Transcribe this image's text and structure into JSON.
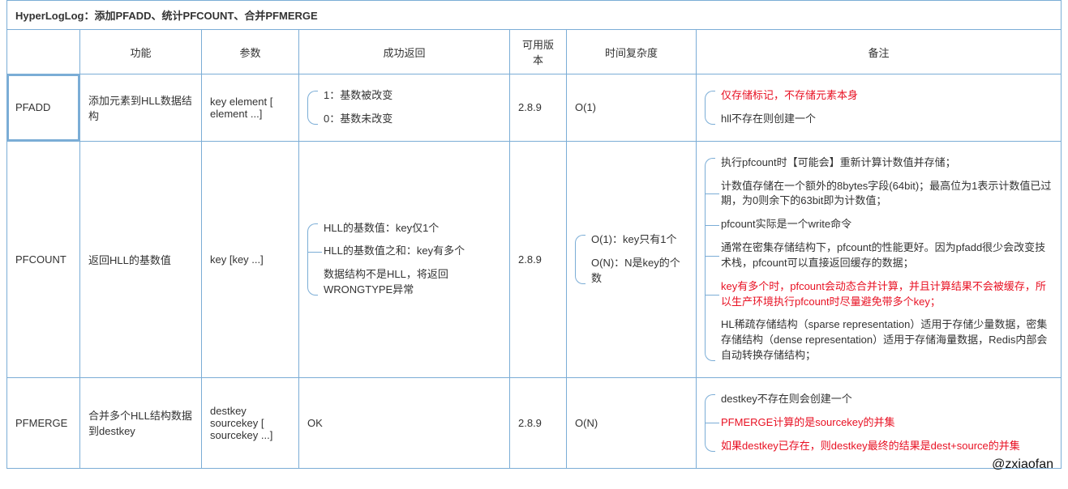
{
  "title": "HyperLogLog：添加PFADD、统计PFCOUNT、合并PFMERGE",
  "watermark": "@zxiaofan",
  "headers": {
    "cmd": "",
    "func": "功能",
    "param": "参数",
    "ret": "成功返回",
    "ver": "可用版本",
    "complexity": "时间复杂度",
    "note": "备注"
  },
  "rows": [
    {
      "cmd": "PFADD",
      "func": "添加元素到HLL数据结构",
      "param": "key element [ element ...]",
      "ret": {
        "items": [
          {
            "text": "1：基数被改变"
          },
          {
            "text": "0：基数未改变"
          }
        ]
      },
      "ver": "2.8.9",
      "complexity": {
        "plain": "O(1)"
      },
      "note": {
        "items": [
          {
            "text": "仅存储标记，不存储元素本身",
            "red": true
          },
          {
            "text": "hll不存在则创建一个"
          }
        ]
      }
    },
    {
      "cmd": "PFCOUNT",
      "func": "返回HLL的基数值",
      "param": "key [key ...]",
      "ret": {
        "items": [
          {
            "text": "HLL的基数值：key仅1个"
          },
          {
            "text": "HLL的基数值之和：key有多个"
          },
          {
            "text": "数据结构不是HLL，将返回WRONGTYPE异常"
          }
        ]
      },
      "ver": "2.8.9",
      "complexity": {
        "items": [
          {
            "text": "O(1)：key只有1个"
          },
          {
            "text": "O(N)：N是key的个数"
          }
        ]
      },
      "note": {
        "items": [
          {
            "text": "执行pfcount时【可能会】重新计算计数值并存储；"
          },
          {
            "text": "计数值存储在一个额外的8bytes字段(64bit)；最高位为1表示计数值已过期，为0则余下的63bit即为计数值；"
          },
          {
            "text": "pfcount实际是一个write命令"
          },
          {
            "text": "通常在密集存储结构下，pfcount的性能更好。因为pfadd很少会改变技术栈，pfcount可以直接返回缓存的数据；"
          },
          {
            "text": "key有多个时，pfcount会动态合并计算，并且计算结果不会被缓存，所以生产环境执行pfcount时尽量避免带多个key；",
            "red": true
          },
          {
            "text": "HL稀疏存储结构（sparse representation）适用于存储少量数据，密集存储结构（dense representation）适用于存储海量数据，Redis内部会自动转换存储结构；"
          }
        ]
      }
    },
    {
      "cmd": "PFMERGE",
      "func": "合并多个HLL结构数据到destkey",
      "param": "destkey sourcekey [ sourcekey ...]",
      "ret": {
        "plain": "OK"
      },
      "ver": "2.8.9",
      "complexity": {
        "plain": "O(N)"
      },
      "note": {
        "items": [
          {
            "text": "destkey不存在则会创建一个"
          },
          {
            "text": "PFMERGE计算的是sourcekey的并集",
            "red": true
          },
          {
            "text": "如果destkey已存在，则destkey最终的结果是dest+source的并集",
            "red": true
          }
        ]
      }
    }
  ]
}
